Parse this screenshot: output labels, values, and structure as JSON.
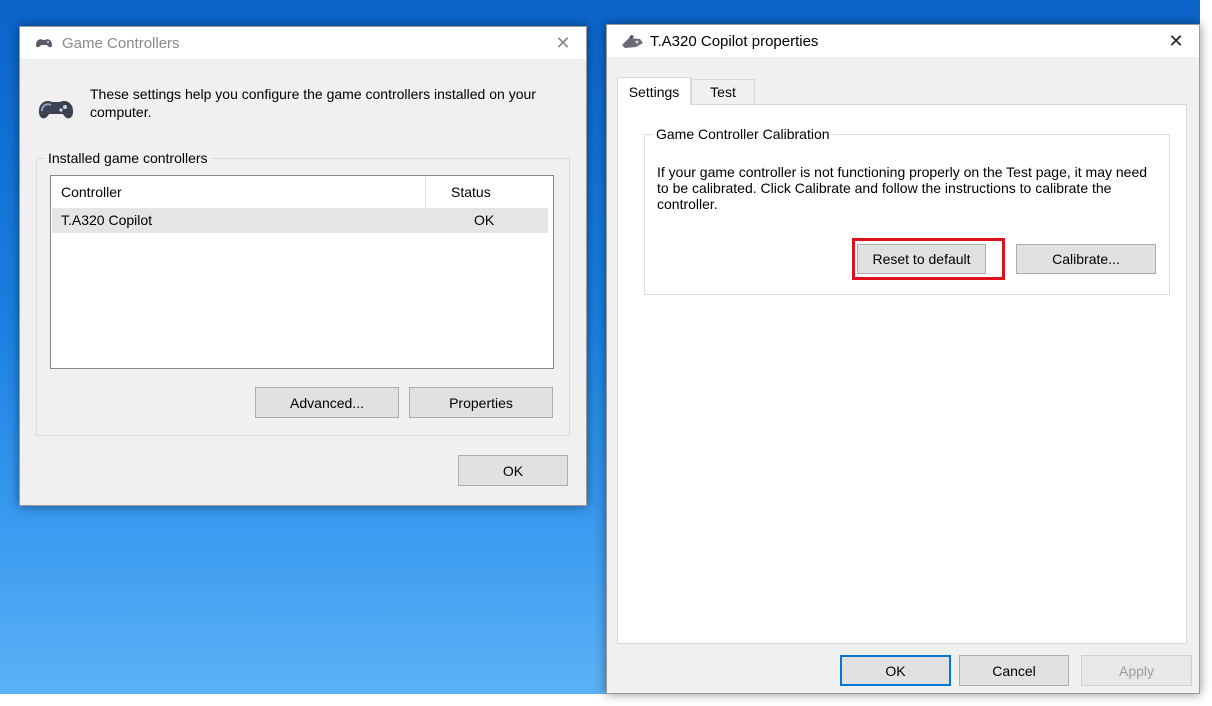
{
  "game_controllers_window": {
    "title": "Game Controllers",
    "close_glyph": "✕",
    "description": "These settings help you configure the game controllers installed on your computer.",
    "group_label": "Installed game controllers",
    "columns": {
      "controller": "Controller",
      "status": "Status"
    },
    "rows": [
      {
        "name": "T.A320 Copilot",
        "status": "OK"
      }
    ],
    "advanced_label": "Advanced...",
    "properties_label": "Properties",
    "ok_label": "OK"
  },
  "properties_window": {
    "title": "T.A320 Copilot properties",
    "close_glyph": "✕",
    "tabs": [
      {
        "label": "Settings",
        "active": true
      },
      {
        "label": "Test",
        "active": false
      }
    ],
    "calibration_group_label": "Game Controller Calibration",
    "calibration_text": "If your game controller is not functioning properly on the Test page, it may need to be calibrated.  Click Calibrate and follow the instructions to calibrate the controller.",
    "reset_label": "Reset to default",
    "calibrate_label": "Calibrate...",
    "ok_label": "OK",
    "cancel_label": "Cancel",
    "apply_label": "Apply"
  },
  "colors": {
    "highlight": "#e0101e",
    "default_button_border": "#0078d7",
    "desktop": "#1a7fe0"
  },
  "icons": [
    "gamepad-icon",
    "joystick-icon",
    "close-icon"
  ]
}
